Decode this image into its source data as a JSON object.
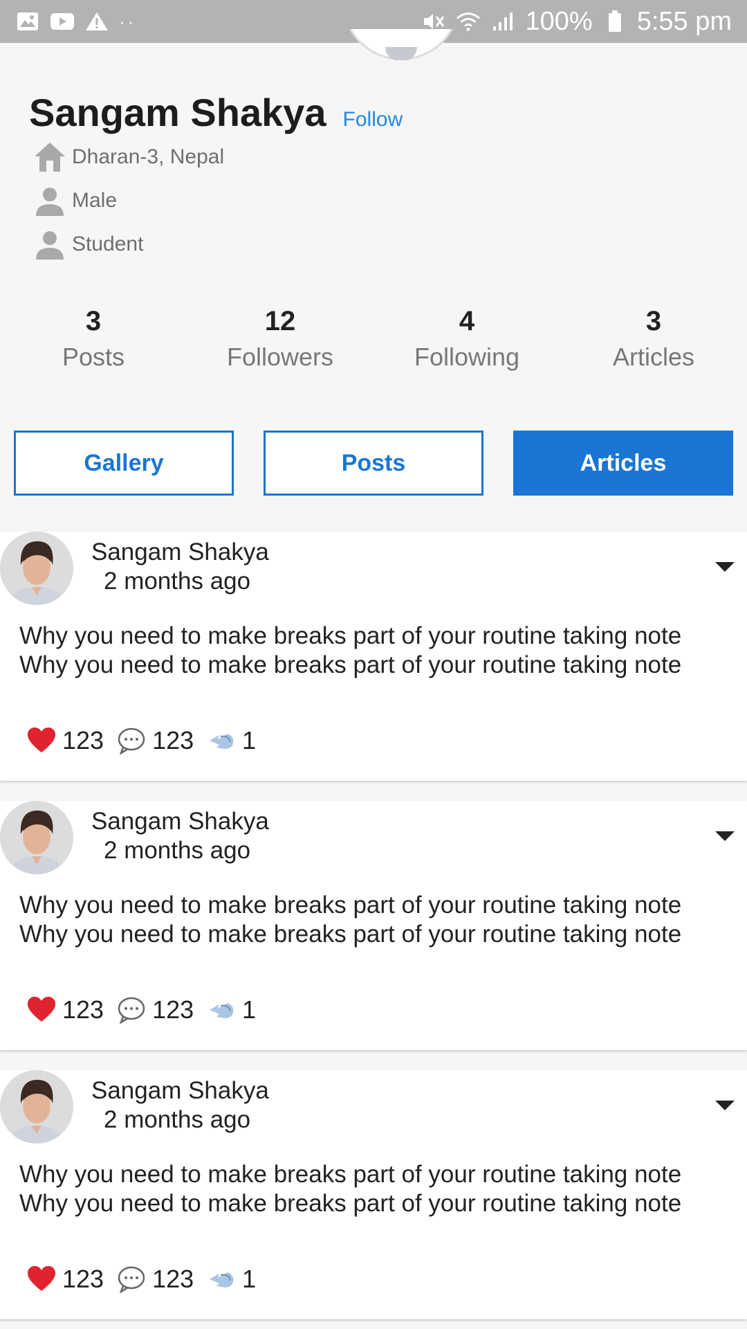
{
  "status_bar": {
    "battery_label": "100%",
    "time": "5:55 pm",
    "dots": "··",
    "colors": {
      "background": "#b3b3b3",
      "foreground": "#ffffff"
    }
  },
  "profile": {
    "name": "Sangam Shakya",
    "follow_label": "Follow",
    "location": "Dharan-3, Nepal",
    "gender": "Male",
    "occupation": "Student",
    "icons": {
      "location": "home-icon",
      "gender": "person-icon",
      "occupation": "person-icon"
    }
  },
  "stats": [
    {
      "value": "3",
      "label": "Posts"
    },
    {
      "value": "12",
      "label": "Followers"
    },
    {
      "value": "4",
      "label": "Following"
    },
    {
      "value": "3",
      "label": "Articles"
    }
  ],
  "tabs": [
    {
      "label": "Gallery",
      "active": false
    },
    {
      "label": "Posts",
      "active": false
    },
    {
      "label": "Articles",
      "active": true
    }
  ],
  "posts": [
    {
      "author": "Sangam Shakya",
      "time": "2 months ago",
      "lines": [
        "Why you need to make breaks part of your routine taking note",
        "Why you need to make breaks part of your routine taking note"
      ],
      "likes": "123",
      "comments": "123",
      "shares": "1"
    },
    {
      "author": "Sangam Shakya",
      "time": "2 months ago",
      "lines": [
        "Why you need to make breaks part of your routine taking note",
        "Why you need to make breaks part of your routine taking note"
      ],
      "likes": "123",
      "comments": "123",
      "shares": "1"
    },
    {
      "author": "Sangam Shakya",
      "time": "2 months ago",
      "lines": [
        "Why you need to make breaks part of your routine taking note",
        "Why you need to make breaks part of your routine taking note"
      ],
      "likes": "123",
      "comments": "123",
      "shares": "1"
    }
  ],
  "colors": {
    "accent": "#1976d2",
    "follow": "#2288dd",
    "page_bg": "#f6f6f6",
    "heart": "#e0232e"
  }
}
